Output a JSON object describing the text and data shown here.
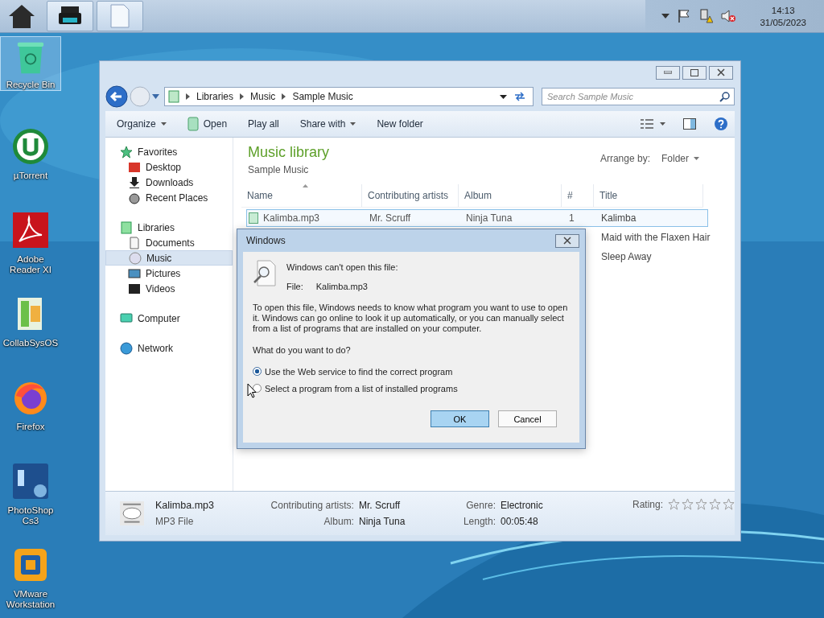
{
  "taskbar": {
    "time": "14:13",
    "date": "31/05/2023"
  },
  "desktop_icons": [
    {
      "label": "Recycle Bin",
      "kind": "recycle",
      "selected": true
    },
    {
      "label": "µTorrent",
      "kind": "torrent",
      "selected": false
    },
    {
      "label": "Adobe Reader XI",
      "kind": "reader",
      "selected": false
    },
    {
      "label": "CollabSysOS",
      "kind": "folder",
      "selected": false
    },
    {
      "label": "Firefox",
      "kind": "firefox",
      "selected": false
    },
    {
      "label": "PhotoShop Cs3",
      "kind": "photoshop",
      "selected": false
    },
    {
      "label": "VMware Workstation",
      "kind": "vmware",
      "selected": false
    }
  ],
  "explorer": {
    "breadcrumb": [
      "Libraries",
      "Music",
      "Sample Music"
    ],
    "search": {
      "placeholder": "Search Sample Music"
    },
    "toolbar": [
      {
        "label": "Organize",
        "kind": "menu"
      },
      {
        "label": "Open",
        "kind": "icon"
      },
      {
        "label": "Play all",
        "kind": "plain"
      },
      {
        "label": "Share with",
        "kind": "menu"
      },
      {
        "label": "New folder",
        "kind": "plain"
      }
    ],
    "nav": [
      {
        "label": "Favorites",
        "kind": "star",
        "children": [
          {
            "label": "Desktop",
            "kind": "desktop",
            "selected": false
          },
          {
            "label": "Downloads",
            "kind": "download",
            "selected": false
          },
          {
            "label": "Recent Places",
            "kind": "recent",
            "selected": false
          }
        ]
      },
      {
        "label": "Libraries",
        "kind": "library",
        "children": [
          {
            "label": "Documents",
            "kind": "documents",
            "selected": false
          },
          {
            "label": "Music",
            "kind": "music",
            "selected": true
          },
          {
            "label": "Pictures",
            "kind": "pictures",
            "selected": false
          },
          {
            "label": "Videos",
            "kind": "videos",
            "selected": false
          }
        ]
      },
      {
        "label": "Computer",
        "kind": "computer"
      },
      {
        "label": "Network",
        "kind": "network"
      }
    ],
    "library": {
      "title": "Music library",
      "subtitle": "Sample Music",
      "arrange_label": "Arrange by:",
      "arrange_value": "Folder"
    },
    "columns": [
      "Name",
      "Contributing artists",
      "Album",
      "#",
      "Title"
    ],
    "rows": [
      {
        "cells": [
          "Kalimba.mp3",
          "Mr. Scruff",
          "Ninja Tuna",
          "1",
          "Kalimba"
        ],
        "selected": true
      },
      {
        "cells": [
          null,
          null,
          null,
          null,
          "Maid with the Flaxen Hair"
        ],
        "selected": false
      },
      {
        "cells": [
          null,
          null,
          null,
          null,
          "Sleep Away"
        ],
        "selected": false
      }
    ],
    "details": {
      "name": "Kalimba.mp3",
      "type": "MP3 File",
      "fields": [
        {
          "label": "Contributing artists:",
          "value": "Mr. Scruff"
        },
        {
          "label": "Genre:",
          "value": "Electronic"
        },
        {
          "label": "Album:",
          "value": "Ninja Tuna"
        },
        {
          "label": "Length:",
          "value": "00:05:48"
        }
      ],
      "rating_label": "Rating:",
      "stars": 0
    }
  },
  "dialog": {
    "title": "Windows",
    "heading": "Windows can't open this file:",
    "file_label": "File:",
    "file_name": "Kalimba.mp3",
    "body": "To open this file, Windows needs to know what program you want to use to open it. Windows can go online to look it up automatically, or you can manually select from a list of programs that are installed on your computer.",
    "question": "What do you want to do?",
    "options": [
      {
        "label": "Use the Web service to find the correct program",
        "selected": true
      },
      {
        "label": "Select a program from a list of installed programs",
        "selected": false
      }
    ],
    "buttons": [
      {
        "label": "OK",
        "default": true
      },
      {
        "label": "Cancel",
        "default": false
      }
    ]
  }
}
